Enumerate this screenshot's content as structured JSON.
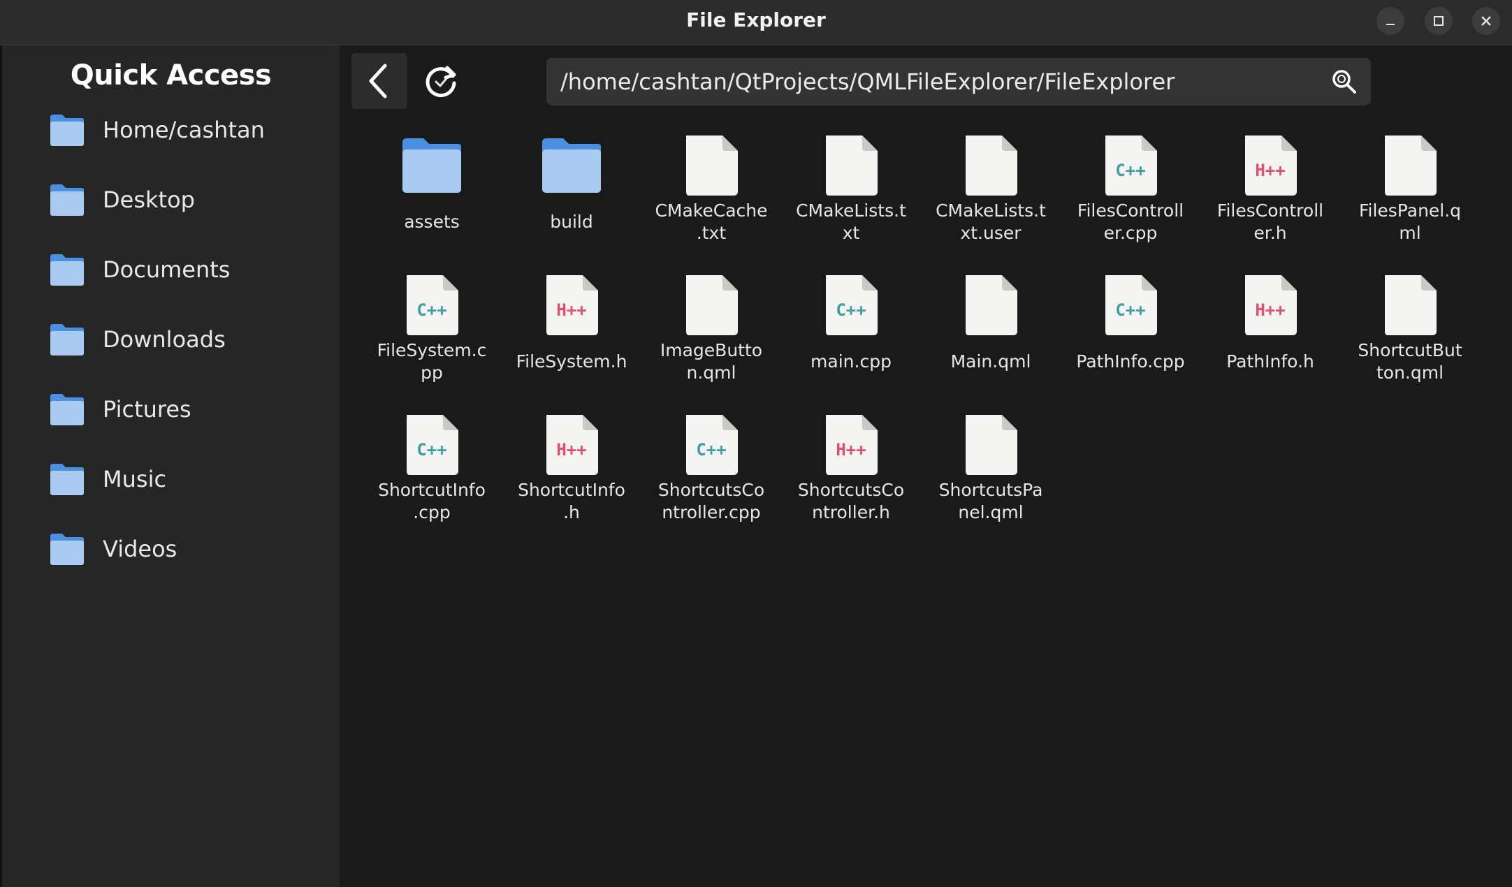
{
  "window": {
    "title": "File Explorer",
    "controls": [
      "minimize-icon",
      "maximize-icon",
      "close-icon"
    ]
  },
  "sidebar": {
    "heading": "Quick Access",
    "items": [
      {
        "label": "Home/cashtan",
        "icon": "folder-icon"
      },
      {
        "label": "Desktop",
        "icon": "folder-icon"
      },
      {
        "label": "Documents",
        "icon": "folder-icon"
      },
      {
        "label": "Downloads",
        "icon": "folder-icon"
      },
      {
        "label": "Pictures",
        "icon": "folder-icon"
      },
      {
        "label": "Music",
        "icon": "folder-icon"
      },
      {
        "label": "Videos",
        "icon": "folder-icon"
      }
    ]
  },
  "toolbar": {
    "back_icon": "back-arrow-icon",
    "refresh_icon": "refresh-icon",
    "path": "/home/cashtan/QtProjects/QMLFileExplorer/FileExplorer",
    "search_icon": "search-icon"
  },
  "files": [
    {
      "line1": "assets",
      "line2": "",
      "kind": "folder"
    },
    {
      "line1": "build",
      "line2": "",
      "kind": "folder"
    },
    {
      "line1": "CMakeCache",
      "line2": ".txt",
      "kind": "file"
    },
    {
      "line1": "CMakeLists.t",
      "line2": "xt",
      "kind": "file"
    },
    {
      "line1": "CMakeLists.t",
      "line2": "xt.user",
      "kind": "file"
    },
    {
      "line1": "FilesControll",
      "line2": "er.cpp",
      "kind": "cpp"
    },
    {
      "line1": "FilesControll",
      "line2": "er.h",
      "kind": "hpp"
    },
    {
      "line1": "FilesPanel.q",
      "line2": "ml",
      "kind": "file"
    },
    {
      "line1": "FileSystem.c",
      "line2": "pp",
      "kind": "cpp"
    },
    {
      "line1": "FileSystem.h",
      "line2": "",
      "kind": "hpp"
    },
    {
      "line1": "ImageButto",
      "line2": "n.qml",
      "kind": "file"
    },
    {
      "line1": "main.cpp",
      "line2": "",
      "kind": "cpp"
    },
    {
      "line1": "Main.qml",
      "line2": "",
      "kind": "file"
    },
    {
      "line1": "PathInfo.cpp",
      "line2": "",
      "kind": "cpp"
    },
    {
      "line1": "PathInfo.h",
      "line2": "",
      "kind": "hpp"
    },
    {
      "line1": "ShortcutBut",
      "line2": "ton.qml",
      "kind": "file"
    },
    {
      "line1": "ShortcutInfo",
      "line2": ".cpp",
      "kind": "cpp"
    },
    {
      "line1": "ShortcutInfo",
      "line2": ".h",
      "kind": "hpp"
    },
    {
      "line1": "ShortcutsCo",
      "line2": "ntroller.cpp",
      "kind": "cpp"
    },
    {
      "line1": "ShortcutsCo",
      "line2": "ntroller.h",
      "kind": "hpp"
    },
    {
      "line1": "ShortcutsPa",
      "line2": "nel.qml",
      "kind": "file"
    }
  ],
  "badges": {
    "cpp": "C++",
    "hpp": "H++"
  },
  "colors": {
    "folder_body": "#a9cbf2",
    "folder_tab": "#4a8fe0",
    "file_page": "#f4f4f2",
    "cpp_badge": "#3f9ea4",
    "hpp_badge": "#e0506a"
  }
}
